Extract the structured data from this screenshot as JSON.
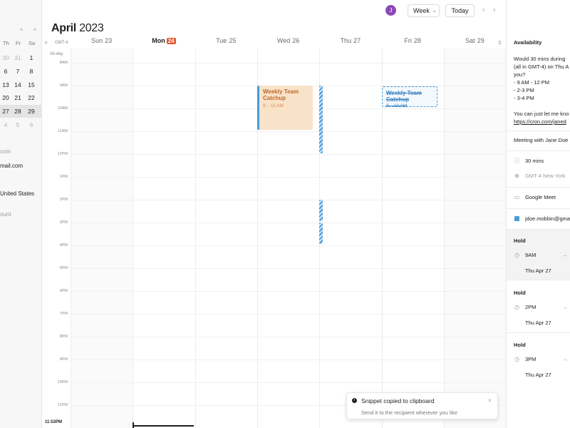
{
  "header": {
    "avatar_initial": "J",
    "view_label": "Week",
    "today_label": "Today",
    "prev_symbol": "‹",
    "next_symbol": "›",
    "month": "April",
    "year": "2023"
  },
  "mini_calendar": {
    "nav_symbols": "^ ^",
    "dow": [
      "Th",
      "Fr",
      "Sa"
    ],
    "rows": [
      {
        "days": [
          "30",
          "31",
          "1"
        ],
        "muted": [
          true,
          true,
          false
        ],
        "selected": false
      },
      {
        "days": [
          "6",
          "7",
          "8"
        ],
        "muted": [
          false,
          false,
          false
        ],
        "selected": false
      },
      {
        "days": [
          "13",
          "14",
          "15"
        ],
        "muted": [
          false,
          false,
          false
        ],
        "selected": false
      },
      {
        "days": [
          "20",
          "21",
          "22"
        ],
        "muted": [
          false,
          false,
          false
        ],
        "selected": false
      },
      {
        "days": [
          "27",
          "28",
          "29"
        ],
        "muted": [
          false,
          false,
          false
        ],
        "selected": true
      },
      {
        "days": [
          "4",
          "5",
          "6"
        ],
        "muted": [
          true,
          true,
          true
        ],
        "selected": false
      }
    ]
  },
  "sidebar": {
    "line1": "com",
    "line2": "mail.com",
    "line3": "United States",
    "line4": "ount"
  },
  "week": {
    "add_symbol": "+",
    "tz": "GMT-4",
    "allday": "All-day",
    "expand_symbol": "±",
    "days": [
      {
        "name": "Sun",
        "num": "23",
        "today": false
      },
      {
        "name": "Mon",
        "num": "24",
        "today": true
      },
      {
        "name": "Tue",
        "num": "25",
        "today": false
      },
      {
        "name": "Wed",
        "num": "26",
        "today": false
      },
      {
        "name": "Thu",
        "num": "27",
        "today": false
      },
      {
        "name": "Fri",
        "num": "28",
        "today": false
      },
      {
        "name": "Sat",
        "num": "29",
        "today": false
      }
    ],
    "hours": [
      "8AM",
      "9AM",
      "10AM",
      "11AM",
      "12PM",
      "1PM",
      "2PM",
      "3PM",
      "4PM",
      "5PM",
      "6PM",
      "7PM",
      "8PM",
      "9PM",
      "10PM",
      "11PM"
    ],
    "now_label": "11:53PM"
  },
  "events": {
    "weekly": {
      "title": "Weekly Team Catchup",
      "time": "9 – 11 AM"
    },
    "proposed": {
      "title": "Weekly Team Catchup",
      "time": "9 – 10 AM"
    }
  },
  "right_panel": {
    "title": "Availability",
    "msg_line1": "Would 30 mins during",
    "msg_line2": "(all in GMT-4) on Thu A",
    "msg_line3": "you?",
    "slot1": "- 9 AM - 12 PM",
    "slot2": "- 2-3 PM",
    "slot3": "- 3-4 PM",
    "closing": "You can just let me kno",
    "link": "https://cron.com/janed",
    "meeting_title": "Meeting with Jane Doe",
    "duration": "30 mins",
    "timezone": "GMT-4  New York",
    "conferencing": "Google Meet",
    "calendar": "jdoe.mobbin@gma",
    "holds": [
      {
        "label": "Hold",
        "time": "9AM",
        "date": "Thu Apr 27"
      },
      {
        "label": "Hold",
        "time": "2PM",
        "date": "Thu Apr 27"
      },
      {
        "label": "Hold",
        "time": "3PM",
        "date": "Thu Apr 27"
      }
    ]
  },
  "toast": {
    "icon": "i",
    "title": "Snippet copied to clipboard",
    "subtitle": "Send it to the recipient wherever you like",
    "close": "×"
  },
  "colors": {
    "accent_blue": "#4a9bd6",
    "today_badge": "#e8542e",
    "event_fill": "#f8e2c8",
    "avatar": "#8b4ab4"
  }
}
